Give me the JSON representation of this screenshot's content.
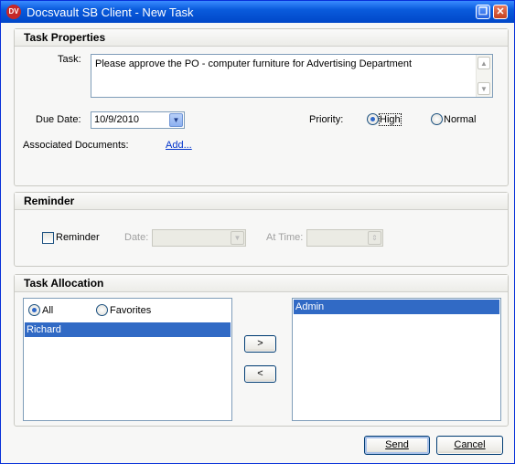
{
  "window": {
    "logo_text": "DV",
    "title": "Docsvault SB Client - New Task",
    "restore_symbol": "❐",
    "close_symbol": "✕"
  },
  "task_properties": {
    "header": "Task Properties",
    "task_label": "Task:",
    "task_value": "Please approve the PO - computer furniture for Advertising Department",
    "due_date_label": "Due Date:",
    "due_date_value": "10/9/2010",
    "priority_label": "Priority:",
    "priority_options": [
      {
        "label": "High",
        "selected": true
      },
      {
        "label": "Normal",
        "selected": false
      }
    ],
    "assoc_docs_label": "Associated Documents:",
    "add_link": "Add..."
  },
  "reminder": {
    "header": "Reminder",
    "checkbox_label": "Reminder",
    "checked": false,
    "date_label": "Date:",
    "date_value": "",
    "time_label": "At Time:",
    "time_value": ""
  },
  "task_allocation": {
    "header": "Task Allocation",
    "filter_options": [
      {
        "label": "All",
        "selected": true
      },
      {
        "label": "Favorites",
        "selected": false
      }
    ],
    "available_users": [
      "Richard"
    ],
    "assigned_users": [
      "Admin"
    ],
    "add_button": ">",
    "remove_button": "<"
  },
  "footer": {
    "send_label": "Send",
    "cancel_label": "Cancel"
  },
  "icons": {
    "scroll_up": "▲",
    "scroll_down": "▼",
    "dropdown": "▼",
    "spinner": "⇕"
  },
  "colors": {
    "title_bar": "#0a5bdc",
    "selection": "#316ac5",
    "radio_selected": "#21a121",
    "link": "#0033cc"
  }
}
